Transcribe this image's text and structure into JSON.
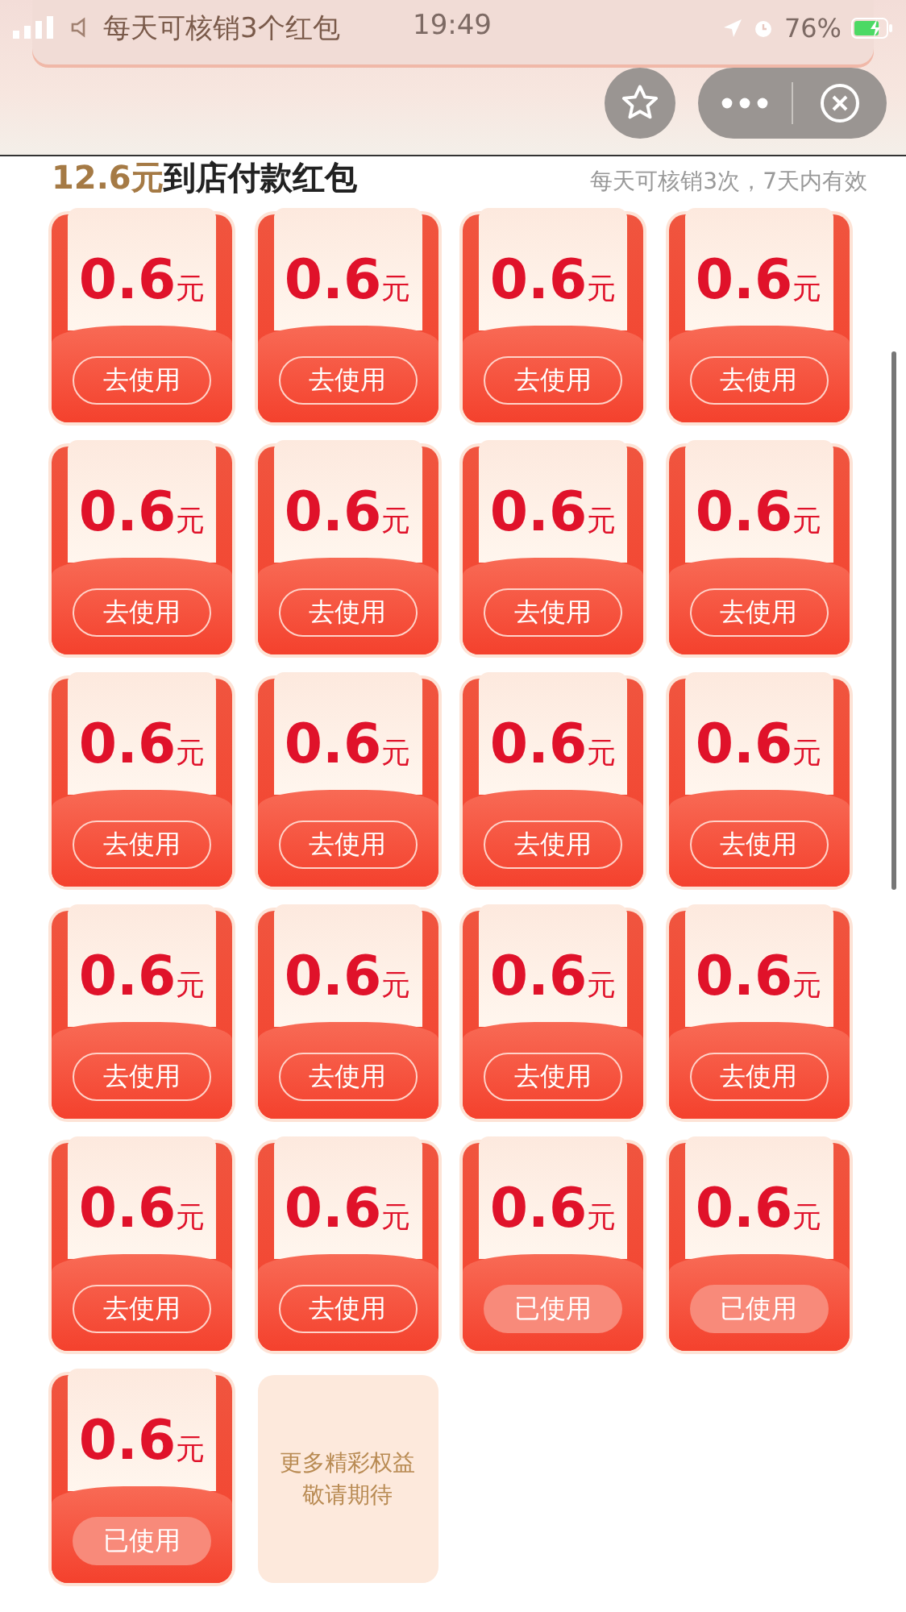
{
  "status_bar": {
    "time": "19:49",
    "battery": "76%",
    "charging": true
  },
  "banner": {
    "text": "每天可核销3个红包"
  },
  "header": {
    "amount": "12.6元",
    "title": "到店付款红包",
    "note": "每天可核销3次，7天内有效"
  },
  "coupons": [
    {
      "amount": "0.6",
      "unit": "元",
      "button": "去使用",
      "used": false
    },
    {
      "amount": "0.6",
      "unit": "元",
      "button": "去使用",
      "used": false
    },
    {
      "amount": "0.6",
      "unit": "元",
      "button": "去使用",
      "used": false
    },
    {
      "amount": "0.6",
      "unit": "元",
      "button": "去使用",
      "used": false
    },
    {
      "amount": "0.6",
      "unit": "元",
      "button": "去使用",
      "used": false
    },
    {
      "amount": "0.6",
      "unit": "元",
      "button": "去使用",
      "used": false
    },
    {
      "amount": "0.6",
      "unit": "元",
      "button": "去使用",
      "used": false
    },
    {
      "amount": "0.6",
      "unit": "元",
      "button": "去使用",
      "used": false
    },
    {
      "amount": "0.6",
      "unit": "元",
      "button": "去使用",
      "used": false
    },
    {
      "amount": "0.6",
      "unit": "元",
      "button": "去使用",
      "used": false
    },
    {
      "amount": "0.6",
      "unit": "元",
      "button": "去使用",
      "used": false
    },
    {
      "amount": "0.6",
      "unit": "元",
      "button": "去使用",
      "used": false
    },
    {
      "amount": "0.6",
      "unit": "元",
      "button": "去使用",
      "used": false
    },
    {
      "amount": "0.6",
      "unit": "元",
      "button": "去使用",
      "used": false
    },
    {
      "amount": "0.6",
      "unit": "元",
      "button": "去使用",
      "used": false
    },
    {
      "amount": "0.6",
      "unit": "元",
      "button": "去使用",
      "used": false
    },
    {
      "amount": "0.6",
      "unit": "元",
      "button": "去使用",
      "used": false
    },
    {
      "amount": "0.6",
      "unit": "元",
      "button": "去使用",
      "used": false
    },
    {
      "amount": "0.6",
      "unit": "元",
      "button": "已使用",
      "used": true
    },
    {
      "amount": "0.6",
      "unit": "元",
      "button": "已使用",
      "used": true
    },
    {
      "amount": "0.6",
      "unit": "元",
      "button": "已使用",
      "used": true
    }
  ],
  "more_card": {
    "lines": [
      "更多精彩权益",
      "敬请期待"
    ]
  }
}
